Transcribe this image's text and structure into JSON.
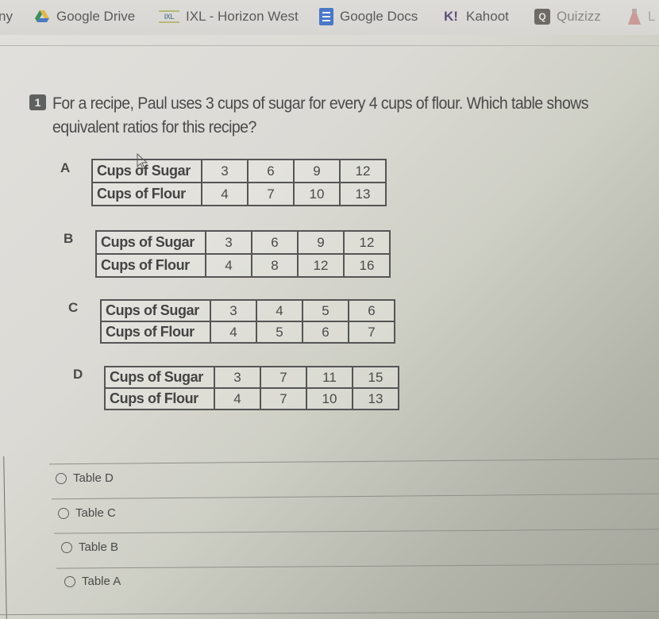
{
  "bookmarks": [
    {
      "label": "ny",
      "icon": "none"
    },
    {
      "label": "Google Drive",
      "icon": "google-drive-icon"
    },
    {
      "label": "IXL - Horizon West",
      "icon": "ixl-icon",
      "icon_text": "IXL"
    },
    {
      "label": "Google Docs",
      "icon": "google-docs-icon"
    },
    {
      "label": "Kahoot",
      "icon": "kahoot-icon",
      "icon_text": "K!"
    },
    {
      "label": "Quizizz",
      "icon": "quizizz-icon",
      "icon_text": "Q"
    },
    {
      "label": "L",
      "icon": "lab-flask-icon"
    }
  ],
  "question": {
    "number": "1",
    "text": "For a recipe, Paul uses 3 cups of sugar for every 4 cups of flour. Which table shows equivalent ratios for this recipe?"
  },
  "tables": [
    {
      "letter": "A",
      "rows": [
        {
          "label": "Cups of Sugar",
          "values": [
            "3",
            "6",
            "9",
            "12"
          ]
        },
        {
          "label": "Cups of Flour",
          "values": [
            "4",
            "7",
            "10",
            "13"
          ]
        }
      ]
    },
    {
      "letter": "B",
      "rows": [
        {
          "label": "Cups of Sugar",
          "values": [
            "3",
            "6",
            "9",
            "12"
          ]
        },
        {
          "label": "Cups of Flour",
          "values": [
            "4",
            "8",
            "12",
            "16"
          ]
        }
      ]
    },
    {
      "letter": "C",
      "rows": [
        {
          "label": "Cups of Sugar",
          "values": [
            "3",
            "4",
            "5",
            "6"
          ]
        },
        {
          "label": "Cups of Flour",
          "values": [
            "4",
            "5",
            "6",
            "7"
          ]
        }
      ]
    },
    {
      "letter": "D",
      "rows": [
        {
          "label": "Cups of Sugar",
          "values": [
            "3",
            "7",
            "11",
            "15"
          ]
        },
        {
          "label": "Cups of Flour",
          "values": [
            "4",
            "7",
            "10",
            "13"
          ]
        }
      ]
    }
  ],
  "answers": [
    {
      "label": "Table D",
      "selected": false
    },
    {
      "label": "Table C",
      "selected": false
    },
    {
      "label": "Table B",
      "selected": false
    },
    {
      "label": "Table A",
      "selected": false
    }
  ],
  "colors": {
    "question_badge": "#5f6160",
    "docs_icon": "#4a78c9",
    "kahoot_icon": "#5d4f7a"
  }
}
